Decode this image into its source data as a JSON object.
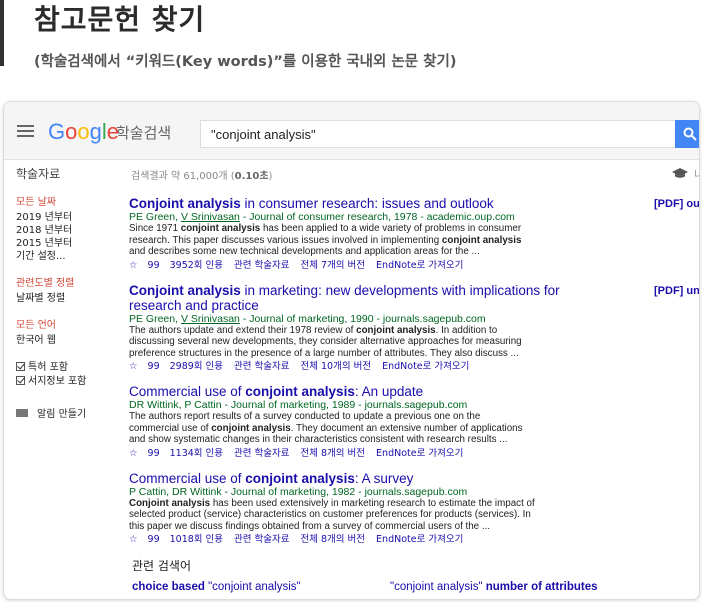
{
  "guide": {
    "title": "참고문헌 찾기",
    "subtitle": "(학술검색에서 “키워드(Key words)”를 이용한 국내외 논문 찾기)"
  },
  "topbar": {
    "logo_letters": [
      "G",
      "o",
      "o",
      "g",
      "l",
      "e"
    ],
    "scholar_label": "학술검색",
    "search_value": "\"conjoint analysis\"",
    "search_icon": "search-icon"
  },
  "navrow": {
    "section_label": "학술자료",
    "count_prefix": "검색결과 약 61,000개 (",
    "count_time": "0.10초",
    "count_suffix": ")",
    "cap_text": "내"
  },
  "sidebar": {
    "date_head": "모든 날짜",
    "date_items": [
      "2019 년부터",
      "2018 년부터",
      "2015 년부터",
      "기간 설정..."
    ],
    "sort_head": "관련도별 정렬",
    "sort_item": "날짜별 정렬",
    "lang_head": "모든 언어",
    "lang_item": "한국어 웹",
    "checks": [
      "특허 포함",
      "서지정보 포함"
    ],
    "alert": "알림 만들기"
  },
  "results": [
    {
      "title_bold": "Conjoint analysis",
      "title_rest": " in consumer research: issues and outlook",
      "meta_a": "PE Green, ",
      "meta_u": "V Srinivasan",
      "meta_b": " - Journal of consumer research, 1978 - academic.oup.com",
      "snip1": "Since 1971 ",
      "snip1b": "conjoint analysis",
      "snip1c": " has been applied to a wide variety of problems in consumer",
      "snip2": "research. This paper discusses various issues involved in implementing ",
      "snip2b": "conjoint analysis",
      "snip3": "and describes some new technical developments and application areas for the ...",
      "cited": "3952회 인용",
      "related": "관련 학술자료",
      "versions": "전체 7개의 버전",
      "endnote": "EndNote로 가져오기",
      "pdf": "[PDF] ou"
    },
    {
      "title_bold": "Conjoint analysis",
      "title_rest": " in marketing: new developments with implications for research and practice",
      "meta_a": "PE Green, ",
      "meta_u": "V Srinivasan",
      "meta_b": " - Journal of marketing, 1990 - journals.sagepub.com",
      "snip1": "The authors update and extend their 1978 review of ",
      "snip1b": "conjoint analysis",
      "snip1c": ". In addition to",
      "snip2": "discussing several new developments, they consider alternative approaches for measuring",
      "snip2b": "",
      "snip3": "preference structures in the presence of a large number of attributes. They also discuss ...",
      "cited": "2989회 인용",
      "related": "관련 학술자료",
      "versions": "전체 10개의 버전",
      "endnote": "EndNote로 가져오기",
      "pdf": "[PDF] un"
    },
    {
      "title_plain": "Commercial use of ",
      "title_bold": "conjoint analysis",
      "title_rest": ": An update",
      "meta_a": "DR Wittink, P Cattin",
      "meta_u": "",
      "meta_b": " - Journal of marketing, 1989 - journals.sagepub.com",
      "snip1": "The authors report results of a survey conducted to update a previous one on the",
      "snip1b": "",
      "snip1c": "",
      "snip2": "commercial use of ",
      "snip2b": "conjoint analysis",
      "snip2c": ". They document an extensive number of applications",
      "snip3": "and show systematic changes in their characteristics consistent with research results ...",
      "cited": "1134회 인용",
      "related": "관련 학술자료",
      "versions": "전체 8개의 버전",
      "endnote": "EndNote로 가져오기"
    },
    {
      "title_plain": "Commercial use of ",
      "title_bold": "conjoint analysis",
      "title_rest": ": A survey",
      "meta_a": "P Cattin, DR Wittink",
      "meta_u": "",
      "meta_b": " - Journal of marketing, 1982 - journals.sagepub.com",
      "snip0b": "Conjoint analysis",
      "snip1": " has been used extensively in marketing research to estimate the impact of",
      "snip2": "selected product (service) characteristics on customer preferences for products (services). In",
      "snip3": "this paper we discuss findings obtained from a survey of commercial users of the ...",
      "cited": "1018회 인용",
      "related": "관련 학술자료",
      "versions": "전체 8개의 버전",
      "endnote": "EndNote로 가져오기"
    }
  ],
  "related_searches": {
    "title": "관련 검색어",
    "items": [
      {
        "bold": "choice based",
        "plain": " \"conjoint analysis\""
      },
      {
        "plain": "\"conjoint analysis\"",
        "bold": " number of attributes"
      }
    ]
  },
  "colors": {
    "link": "#1a0dab",
    "meta": "#006621",
    "filter_head": "#d14836",
    "search_button": "#4285f4"
  }
}
